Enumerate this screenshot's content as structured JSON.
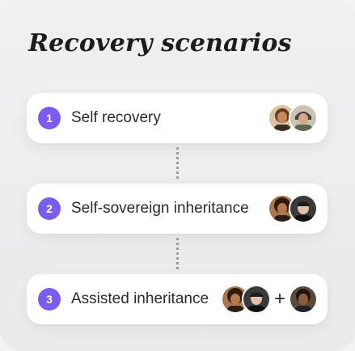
{
  "title": "Recovery scenarios",
  "scenarios": [
    {
      "number": "1",
      "label": "Self recovery",
      "avatars": [
        "person-a-avatar",
        "person-b-avatar"
      ]
    },
    {
      "number": "2",
      "label": "Self-sovereign inheritance",
      "avatars": [
        "person-c-avatar",
        "person-d-avatar"
      ]
    },
    {
      "number": "3",
      "label": "Assisted inheritance",
      "avatars": [
        "person-c-avatar",
        "person-d-avatar",
        "person-e-avatar"
      ],
      "plus": "+"
    }
  ],
  "colors": {
    "accent": "#7b5cf0",
    "card": "#ffffff",
    "background": "#efeff0"
  }
}
